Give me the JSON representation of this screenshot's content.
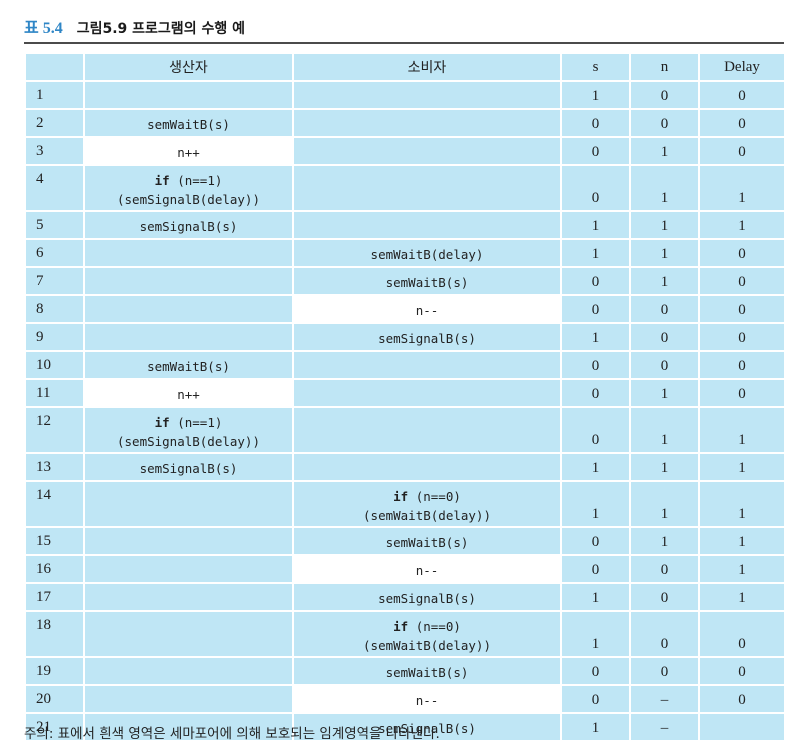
{
  "caption": {
    "number": "표 5.4",
    "title": "그림5.9 프로그램의 수행 예"
  },
  "columns": [
    "",
    "생산자",
    "소비자",
    "s",
    "n",
    "Delay"
  ],
  "rows": [
    {
      "idx": "1",
      "producer": [],
      "producer_crit": false,
      "consumer": [],
      "consumer_crit": false,
      "s": "1",
      "n": "0",
      "d": "0"
    },
    {
      "idx": "2",
      "producer": [
        {
          "kw": "",
          "rest": "semWaitB(s)"
        }
      ],
      "producer_crit": false,
      "consumer": [],
      "consumer_crit": false,
      "s": "0",
      "n": "0",
      "d": "0"
    },
    {
      "idx": "3",
      "producer": [
        {
          "kw": "",
          "rest": "n++"
        }
      ],
      "producer_crit": true,
      "consumer": [],
      "consumer_crit": false,
      "s": "0",
      "n": "1",
      "d": "0"
    },
    {
      "idx": "4",
      "producer": [
        {
          "kw": "if",
          "rest": " (n==1)"
        },
        {
          "kw": "",
          "rest": "(semSignalB(delay))"
        }
      ],
      "producer_crit": false,
      "consumer": [],
      "consumer_crit": false,
      "s": "0",
      "n": "1",
      "d": "1"
    },
    {
      "idx": "5",
      "producer": [
        {
          "kw": "",
          "rest": "semSignalB(s)"
        }
      ],
      "producer_crit": false,
      "consumer": [],
      "consumer_crit": false,
      "s": "1",
      "n": "1",
      "d": "1"
    },
    {
      "idx": "6",
      "producer": [],
      "producer_crit": false,
      "consumer": [
        {
          "kw": "",
          "rest": "semWaitB(delay)"
        }
      ],
      "consumer_crit": false,
      "s": "1",
      "n": "1",
      "d": "0"
    },
    {
      "idx": "7",
      "producer": [],
      "producer_crit": false,
      "consumer": [
        {
          "kw": "",
          "rest": "semWaitB(s)"
        }
      ],
      "consumer_crit": false,
      "s": "0",
      "n": "1",
      "d": "0"
    },
    {
      "idx": "8",
      "producer": [],
      "producer_crit": false,
      "consumer": [
        {
          "kw": "",
          "rest": "n--"
        }
      ],
      "consumer_crit": true,
      "s": "0",
      "n": "0",
      "d": "0"
    },
    {
      "idx": "9",
      "producer": [],
      "producer_crit": false,
      "consumer": [
        {
          "kw": "",
          "rest": "semSignalB(s)"
        }
      ],
      "consumer_crit": false,
      "s": "1",
      "n": "0",
      "d": "0"
    },
    {
      "idx": "10",
      "producer": [
        {
          "kw": "",
          "rest": "semWaitB(s)"
        }
      ],
      "producer_crit": false,
      "consumer": [],
      "consumer_crit": false,
      "s": "0",
      "n": "0",
      "d": "0"
    },
    {
      "idx": "11",
      "producer": [
        {
          "kw": "",
          "rest": "n++"
        }
      ],
      "producer_crit": true,
      "consumer": [],
      "consumer_crit": false,
      "s": "0",
      "n": "1",
      "d": "0"
    },
    {
      "idx": "12",
      "producer": [
        {
          "kw": "if",
          "rest": " (n==1)"
        },
        {
          "kw": "",
          "rest": "(semSignalB(delay))"
        }
      ],
      "producer_crit": false,
      "consumer": [],
      "consumer_crit": false,
      "s": "0",
      "n": "1",
      "d": "1"
    },
    {
      "idx": "13",
      "producer": [
        {
          "kw": "",
          "rest": "semSignalB(s)"
        }
      ],
      "producer_crit": false,
      "consumer": [],
      "consumer_crit": false,
      "s": "1",
      "n": "1",
      "d": "1"
    },
    {
      "idx": "14",
      "producer": [],
      "producer_crit": false,
      "consumer": [
        {
          "kw": "if",
          "rest": " (n==0)"
        },
        {
          "kw": "",
          "rest": "(semWaitB(delay))"
        }
      ],
      "consumer_crit": false,
      "s": "1",
      "n": "1",
      "d": "1"
    },
    {
      "idx": "15",
      "producer": [],
      "producer_crit": false,
      "consumer": [
        {
          "kw": "",
          "rest": "semWaitB(s)"
        }
      ],
      "consumer_crit": false,
      "s": "0",
      "n": "1",
      "d": "1"
    },
    {
      "idx": "16",
      "producer": [],
      "producer_crit": false,
      "consumer": [
        {
          "kw": "",
          "rest": "n--"
        }
      ],
      "consumer_crit": true,
      "s": "0",
      "n": "0",
      "d": "1"
    },
    {
      "idx": "17",
      "producer": [],
      "producer_crit": false,
      "consumer": [
        {
          "kw": "",
          "rest": "semSignalB(s)"
        }
      ],
      "consumer_crit": false,
      "s": "1",
      "n": "0",
      "d": "1"
    },
    {
      "idx": "18",
      "producer": [],
      "producer_crit": false,
      "consumer": [
        {
          "kw": "if",
          "rest": " (n==0)"
        },
        {
          "kw": "",
          "rest": "(semWaitB(delay))"
        }
      ],
      "consumer_crit": false,
      "s": "1",
      "n": "0",
      "d": "0"
    },
    {
      "idx": "19",
      "producer": [],
      "producer_crit": false,
      "consumer": [
        {
          "kw": "",
          "rest": "semWaitB(s)"
        }
      ],
      "consumer_crit": false,
      "s": "0",
      "n": "0",
      "d": "0"
    },
    {
      "idx": "20",
      "producer": [],
      "producer_crit": false,
      "consumer": [
        {
          "kw": "",
          "rest": "n--"
        }
      ],
      "consumer_crit": true,
      "s": "0",
      "n": "–",
      "d": "0"
    },
    {
      "idx": "21",
      "producer": [],
      "producer_crit": false,
      "consumer": [
        {
          "kw": "",
          "rest": "semSignalB(s)"
        }
      ],
      "consumer_crit": false,
      "s": "1",
      "n": "–",
      "d": ""
    }
  ],
  "note": "주의: 표에서 흰색 영역은 세마포어에 의해 보호되는 임계영역을 나타낸다."
}
